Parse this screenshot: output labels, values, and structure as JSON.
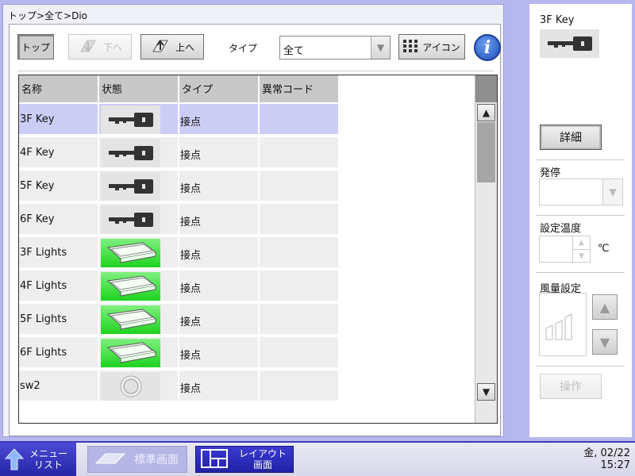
{
  "breadcrumb": "トップ>全て>Dio",
  "toolbar": {
    "top_label": "トップ",
    "down_label": "下へ",
    "up_label": "上へ",
    "type_label": "タイプ",
    "type_value": "全て",
    "icon_label": "アイコン",
    "info_glyph": "i"
  },
  "table": {
    "headers": [
      "名称",
      "状態",
      "タイプ",
      "異常コード"
    ],
    "rows": [
      {
        "name": "3F Key",
        "state": "key",
        "type": "接点",
        "error": ""
      },
      {
        "name": "4F Key",
        "state": "key",
        "type": "接点",
        "error": ""
      },
      {
        "name": "5F Key",
        "state": "key",
        "type": "接点",
        "error": ""
      },
      {
        "name": "6F Key",
        "state": "key",
        "type": "接点",
        "error": ""
      },
      {
        "name": "3F Lights",
        "state": "light-on",
        "type": "接点",
        "error": ""
      },
      {
        "name": "4F Lights",
        "state": "light-on",
        "type": "接点",
        "error": ""
      },
      {
        "name": "5F Lights",
        "state": "light-on",
        "type": "接点",
        "error": ""
      },
      {
        "name": "6F Lights",
        "state": "light-on",
        "type": "接点",
        "error": ""
      },
      {
        "name": "sw2",
        "state": "switch",
        "type": "接点",
        "error": ""
      }
    ]
  },
  "right_panel": {
    "title": "3F Key",
    "detail_label": "詳細",
    "onoff_label": "発停",
    "temp_label": "設定温度",
    "temp_unit": "℃",
    "fan_label": "風量設定",
    "operate_label": "操作"
  },
  "taskbar": {
    "menu_line1": "メニュー",
    "menu_line2": "リスト",
    "standard_label": "標準画面",
    "layout_line1": "レイアウト",
    "layout_line2": "画面",
    "date": "金, 02/22",
    "time": "15:27"
  },
  "colors": {
    "frame": "#b7b7f0",
    "selected_row": "#cccdf5",
    "light_on": "#1ed31e",
    "taskbar_accent": "#2525a6"
  }
}
